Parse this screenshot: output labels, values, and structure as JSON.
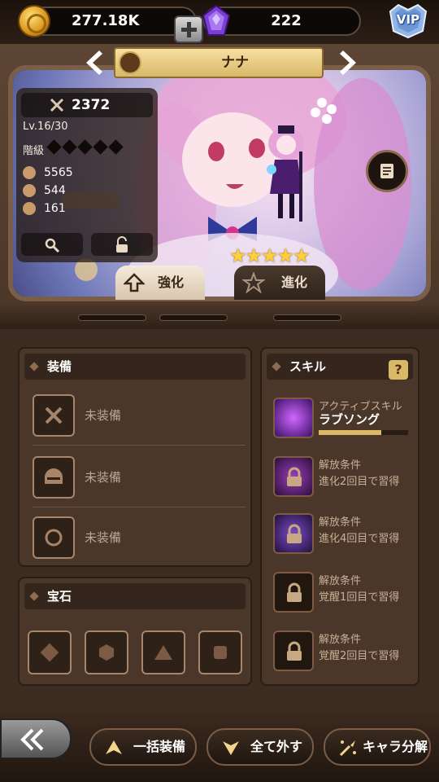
{
  "currency": {
    "gold": "277.18K",
    "gems": "222"
  },
  "vip_label": "VIP",
  "character": {
    "name": "ナナ",
    "power": "2372",
    "level": "Lv.16/30",
    "rank_label": "階級",
    "hp": "5565",
    "attack": "544",
    "defense": "161",
    "stars": 5
  },
  "tabs": [
    {
      "label": "強化",
      "active": true
    },
    {
      "label": "進化",
      "active": false
    }
  ],
  "equipment": {
    "title": "装備",
    "slots": [
      {
        "label": "未装備",
        "icon": "crossed-swords-icon"
      },
      {
        "label": "未装備",
        "icon": "helmet-icon"
      },
      {
        "label": "未装備",
        "icon": "ring-icon"
      }
    ]
  },
  "gems_panel": {
    "title": "宝石",
    "slots": [
      "diamond",
      "hexagon",
      "triangle",
      "square"
    ]
  },
  "skills": {
    "title": "スキル",
    "help": "?",
    "items": [
      {
        "line1": "アクティブスキル",
        "line2": "ラブソング",
        "type": "active"
      },
      {
        "line1": "解放条件",
        "line2": "進化2回目で習得",
        "type": "locked-art"
      },
      {
        "line1": "解放条件",
        "line2": "進化4回目で習得",
        "type": "locked-art"
      },
      {
        "line1": "解放条件",
        "line2": "覚醒1回目で習得",
        "type": "locked"
      },
      {
        "line1": "解放条件",
        "line2": "覚醒2回目で習得",
        "type": "locked"
      }
    ]
  },
  "actions": {
    "equip_all": "一括装備",
    "remove_all": "全て外す",
    "disassemble": "キャラ分解"
  },
  "colors": {
    "accent_gold": "#d9b868",
    "panel": "#4b372a",
    "background": "#3c2b20"
  }
}
